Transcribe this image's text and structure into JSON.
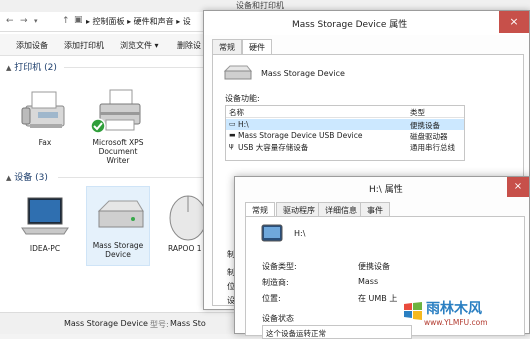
{
  "back_window": {
    "title": "设备和打印机",
    "nav": {
      "back": "←",
      "forward": "→",
      "up": "↑"
    },
    "breadcrumb": "▸  控制面板 ▸ 硬件和声音 ▸ 设",
    "toolbar": {
      "add_device": "添加设备",
      "add_printer": "添加打印机",
      "browse_files": "浏览文件 ▾",
      "remove_device": "删除设"
    },
    "printers_group": "打印机 (2)",
    "printers": [
      {
        "label": "Fax"
      },
      {
        "label": "Microsoft XPS Document Writer"
      }
    ],
    "devices_group": "设备 (3)",
    "devices": [
      {
        "label": "IDEA-PC"
      },
      {
        "label": "Mass Storage Device"
      },
      {
        "label": "RAPOO 1"
      }
    ],
    "status": {
      "device_name": "Mass Storage Device",
      "model_label": "型号:",
      "model_value": "Mass Sto"
    }
  },
  "mid_window": {
    "title": "Mass Storage Device 属性",
    "close": "×",
    "tabs": [
      "常规",
      "硬件"
    ],
    "device_name": "Mass Storage Device",
    "functions_label": "设备功能:",
    "list_headers": {
      "name": "名称",
      "type": "类型"
    },
    "list_rows": [
      {
        "name": "H:\\",
        "type": "便携设备"
      },
      {
        "name": "Mass Storage Device USB Device",
        "type": "磁盘驱动器"
      },
      {
        "name": "USB 大容量存储设备",
        "type": "通用串行总线"
      }
    ],
    "side_labels": [
      "制",
      "制",
      "位",
      "设"
    ]
  },
  "front_window": {
    "title": "H:\\ 属性",
    "close": "×",
    "tabs": [
      "常规",
      "驱动程序",
      "详细信息",
      "事件"
    ],
    "device_name": "H:\\",
    "rows": [
      {
        "key": "设备类型:",
        "value": "便携设备"
      },
      {
        "key": "制造商:",
        "value": "Mass"
      },
      {
        "key": "位置:",
        "value": "在 UMB 上"
      }
    ],
    "status_group": "设备状态",
    "status_text": "这个设备运转正常"
  },
  "watermark": {
    "brand": "雨林木风",
    "url": "www.YLMFU.com"
  }
}
